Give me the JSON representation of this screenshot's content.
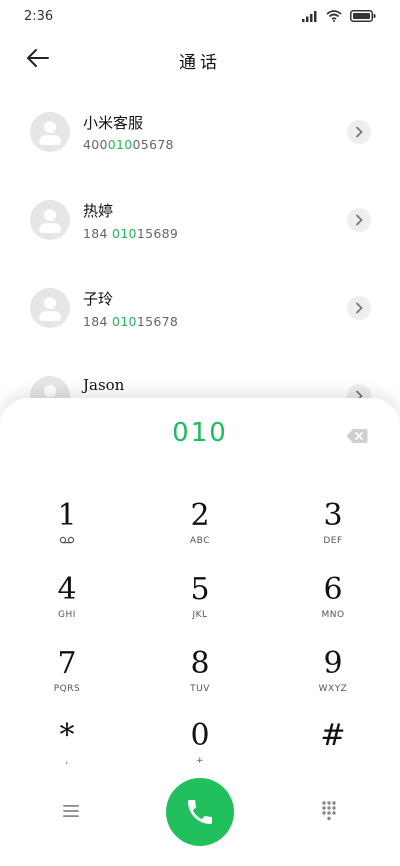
{
  "status": {
    "time": "2:36"
  },
  "header": {
    "title": "通话"
  },
  "contacts": [
    {
      "name": "小米客服",
      "num_pre": "400",
      "num_hl": "010",
      "num_post": "05678"
    },
    {
      "name": "热婷",
      "num_pre": "184 ",
      "num_hl": "010",
      "num_post": "15689"
    },
    {
      "name": "子玲",
      "num_pre": "184 ",
      "num_hl": "010",
      "num_post": "15678"
    },
    {
      "name": "Jason",
      "num_pre": "",
      "num_hl": "",
      "num_post": ""
    }
  ],
  "dialer": {
    "entry": "010",
    "keys": [
      {
        "digit": "1",
        "letters": ""
      },
      {
        "digit": "2",
        "letters": "ABC"
      },
      {
        "digit": "3",
        "letters": "DEF"
      },
      {
        "digit": "4",
        "letters": "GHI"
      },
      {
        "digit": "5",
        "letters": "JKL"
      },
      {
        "digit": "6",
        "letters": "MNO"
      },
      {
        "digit": "7",
        "letters": "PQRS"
      },
      {
        "digit": "8",
        "letters": "TUV"
      },
      {
        "digit": "9",
        "letters": "WXYZ"
      },
      {
        "digit": "*",
        "letters": ","
      },
      {
        "digit": "0",
        "letters": "+"
      },
      {
        "digit": "#",
        "letters": ""
      }
    ]
  },
  "colors": {
    "accent": "#1fbc5c",
    "call_button": "#21c05d"
  },
  "icons": [
    "back-arrow-icon",
    "chevron-right-icon",
    "backspace-icon",
    "voicemail-icon",
    "menu-icon",
    "phone-icon",
    "keypad-icon",
    "signal-icon",
    "wifi-icon",
    "battery-icon"
  ]
}
